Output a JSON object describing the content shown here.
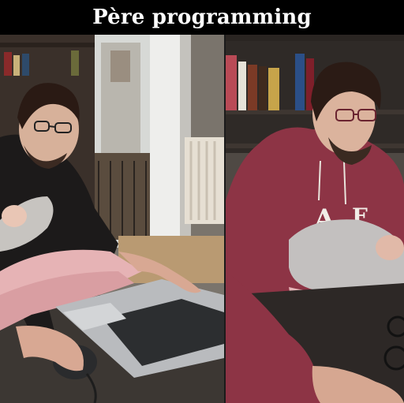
{
  "caption": {
    "text": "Père programming",
    "color": "#ffffff",
    "background": "#000000"
  },
  "photos": [
    {
      "scene": "man-with-glasses-at-laptop-holding-baby"
    },
    {
      "scene": "man-in-red-hoodie-holding-baby-at-desk"
    }
  ]
}
